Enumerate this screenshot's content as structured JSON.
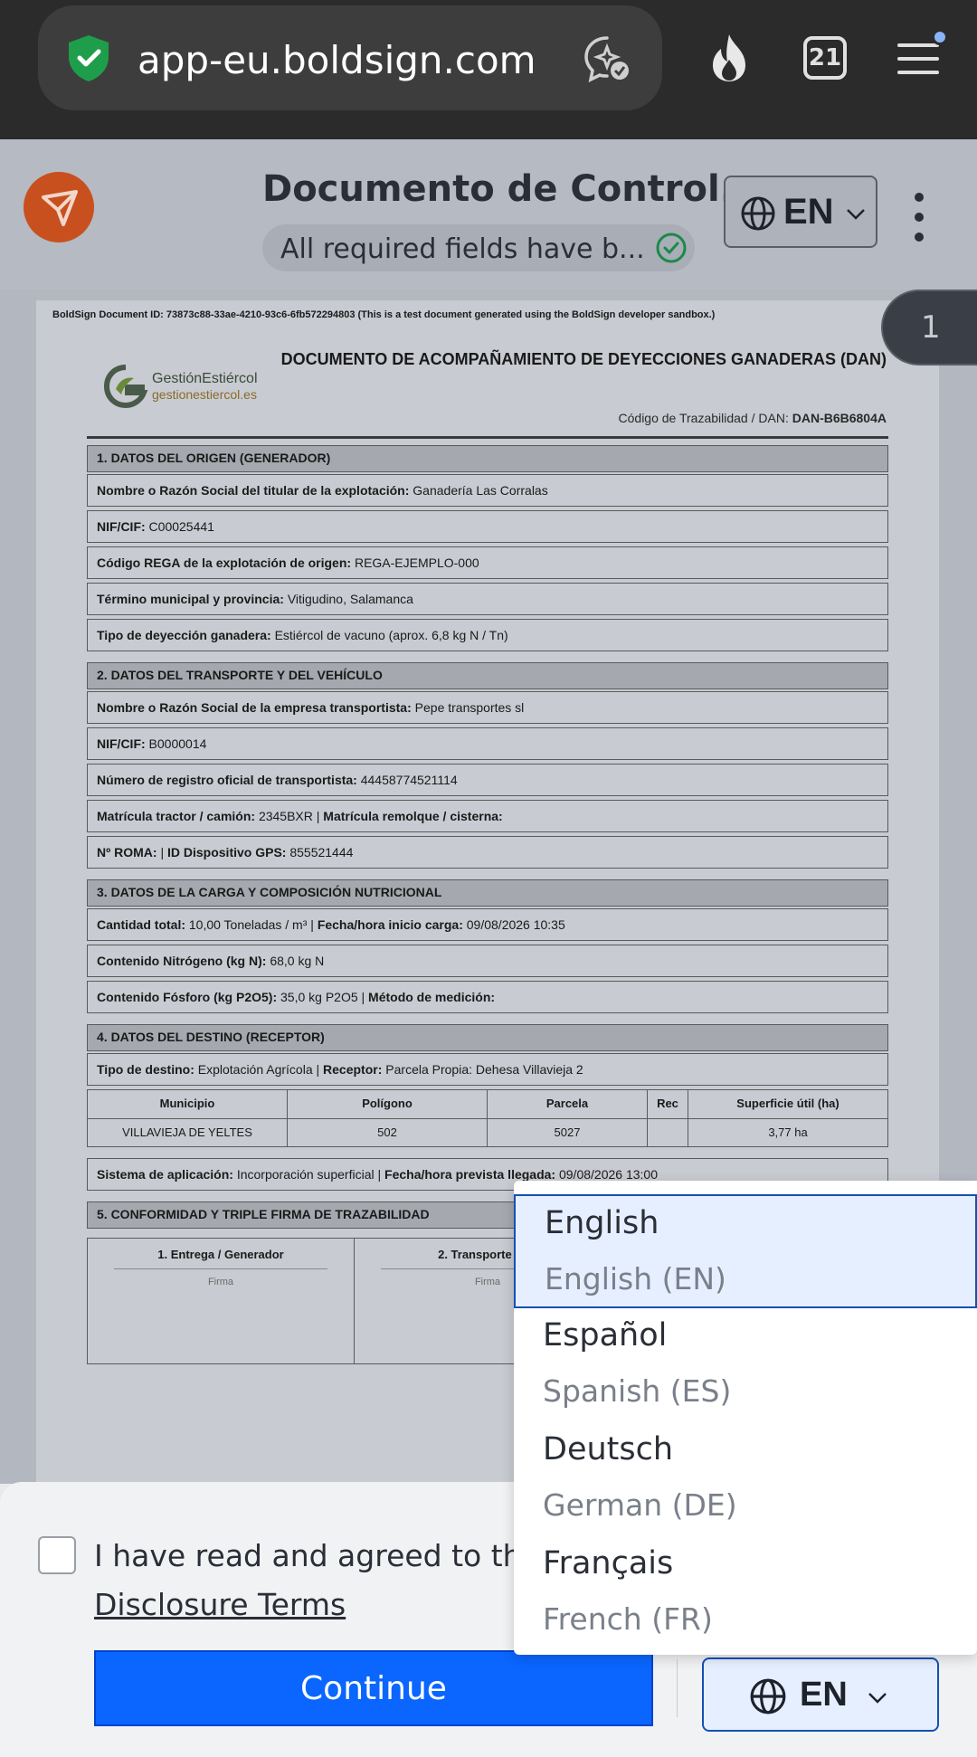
{
  "browser": {
    "url": "app-eu.boldsign.com",
    "tab_count": "21"
  },
  "header": {
    "title": "Documento de Control...",
    "status": "All required fields have b...",
    "language": "EN"
  },
  "document": {
    "page_number": "1",
    "doc_id": "BoldSign Document ID: 73873c88-33ae-4210-93c6-6fb572294803 (This is a test document generated using the BoldSign developer sandbox.)",
    "brand_name": "GestiónEstiércol",
    "brand_url": "gestionestiercol.es",
    "main_title": "DOCUMENTO DE ACOMPAÑAMIENTO DE DEYECCIONES GANADERAS (DAN)",
    "trace_label": "Código de Trazabilidad / DAN:",
    "trace_value": "DAN-B6B6804A",
    "s1": {
      "title": "1. DATOS DEL ORIGEN (GENERADOR)",
      "r1_label": "Nombre o Razón Social del titular de la explotación:",
      "r1_value": "Ganadería Las Corralas",
      "r2_label": "NIF/CIF:",
      "r2_value": "C00025441",
      "r3_label": "Código REGA de la explotación de origen:",
      "r3_value": "REGA-EJEMPLO-000",
      "r4_label": "Término municipal y provincia:",
      "r4_value": "Vitigudino, Salamanca",
      "r5_label": "Tipo de deyección ganadera:",
      "r5_value": "Estiércol de vacuno (aprox. 6,8 kg N / Tn)"
    },
    "s2": {
      "title": "2. DATOS DEL TRANSPORTE Y DEL VEHÍCULO",
      "r1_label": "Nombre o Razón Social de la empresa transportista:",
      "r1_value": "Pepe transportes sl",
      "r2_label": "NIF/CIF:",
      "r2_value": "B0000014",
      "r3_label": "Número de registro oficial de transportista:",
      "r3_value": "44458774521114",
      "r4_label": "Matrícula tractor / camión:",
      "r4_value": "2345BXR |",
      "r4_label2": "Matrícula remolque / cisterna:",
      "r5_label": "Nº ROMA:",
      "r5_value": "|",
      "r5_label2": "ID Dispositivo GPS:",
      "r5_value2": "855521444"
    },
    "s3": {
      "title": "3. DATOS DE LA CARGA Y COMPOSICIÓN NUTRICIONAL",
      "r1_label": "Cantidad total:",
      "r1_value": "10,00 Toneladas / m³ |",
      "r1_label2": "Fecha/hora inicio carga:",
      "r1_value2": "09/08/2026 10:35",
      "r2_label": "Contenido Nitrógeno (kg N):",
      "r2_value": "68,0 kg N",
      "r3_label": "Contenido Fósforo (kg P2O5):",
      "r3_value": "35,0 kg P2O5 |",
      "r3_label2": "Método de medición:"
    },
    "s4": {
      "title": "4. DATOS DEL DESTINO (RECEPTOR)",
      "r1_label": "Tipo de destino:",
      "r1_value": "Explotación Agrícola |",
      "r1_label2": "Receptor:",
      "r1_value2": "Parcela Propia: Dehesa Villavieja 2",
      "table_headers": [
        "Municipio",
        "Polígono",
        "Parcela",
        "Rec",
        "Superficie útil (ha)"
      ],
      "table_row": [
        "VILLAVIEJA DE YELTES",
        "502",
        "5027",
        "",
        "3,77 ha"
      ],
      "r2_label": "Sistema de aplicación:",
      "r2_value": "Incorporación superficial |",
      "r2_label2": "Fecha/hora prevista llegada:",
      "r2_value2": "09/08/2026 13:00"
    },
    "s5": {
      "title": "5. CONFORMIDAD Y TRIPLE FIRMA DE TRAZABILIDAD",
      "col1": "1. Entrega / Generador",
      "col2": "2. Transporte / Co",
      "sign": "Firma"
    }
  },
  "bottom": {
    "agree_text": "I have read and agreed to the",
    "disclosure_link": "Disclosure Terms",
    "continue_label": "Continue",
    "language": "EN"
  },
  "dropdown": {
    "options": [
      {
        "native": "English",
        "sub": "English (EN)"
      },
      {
        "native": "Español",
        "sub": "Spanish (ES)"
      },
      {
        "native": "Deutsch",
        "sub": "German (DE)"
      },
      {
        "native": "Français",
        "sub": "French (FR)"
      }
    ]
  },
  "colors": {
    "primary": "#0a66ff",
    "selected_border": "#1450b4",
    "logo": "#c8501e",
    "success": "#1a8a4a"
  }
}
